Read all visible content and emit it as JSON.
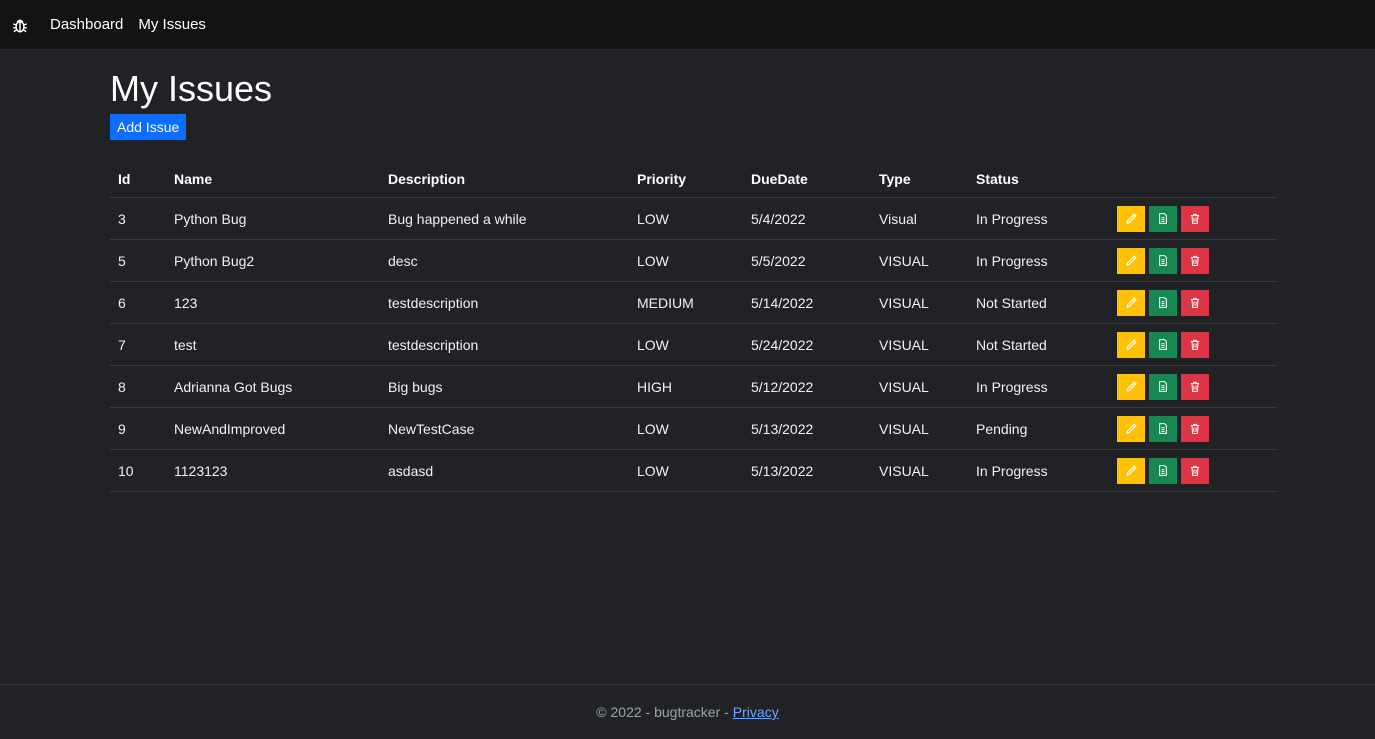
{
  "nav": {
    "brand_icon": "bug-icon",
    "links": [
      "Dashboard",
      "My Issues"
    ]
  },
  "page": {
    "title": "My Issues",
    "add_button": "Add Issue"
  },
  "table": {
    "headers": [
      "Id",
      "Name",
      "Description",
      "Priority",
      "DueDate",
      "Type",
      "Status"
    ],
    "rows": [
      [
        "3",
        "Python Bug",
        "Bug happened a while",
        "LOW",
        "5/4/2022",
        "Visual",
        "In Progress"
      ],
      [
        "5",
        "Python Bug2",
        "desc",
        "LOW",
        "5/5/2022",
        "VISUAL",
        "In Progress"
      ],
      [
        "6",
        "123",
        "testdescription",
        "MEDIUM",
        "5/14/2022",
        "VISUAL",
        "Not Started"
      ],
      [
        "7",
        "test",
        "testdescription",
        "LOW",
        "5/24/2022",
        "VISUAL",
        "Not Started"
      ],
      [
        "8",
        "Adrianna Got Bugs",
        "Big bugs",
        "HIGH",
        "5/12/2022",
        "VISUAL",
        "In Progress"
      ],
      [
        "9",
        "NewAndImproved",
        "NewTestCase",
        "LOW",
        "5/13/2022",
        "VISUAL",
        "Pending"
      ],
      [
        "10",
        "1123123",
        "asdasd",
        "LOW",
        "5/13/2022",
        "VISUAL",
        "In Progress"
      ]
    ],
    "row_actions": [
      "pencil-icon",
      "document-icon",
      "trash-icon"
    ]
  },
  "footer": {
    "text": "© 2022 - bugtracker -",
    "privacy_link": "Privacy"
  },
  "colors": {
    "primary": "#0d6efd",
    "warning": "#ffc107",
    "success": "#198754",
    "danger": "#dc3545",
    "background": "#212225",
    "navbar": "#131313"
  }
}
